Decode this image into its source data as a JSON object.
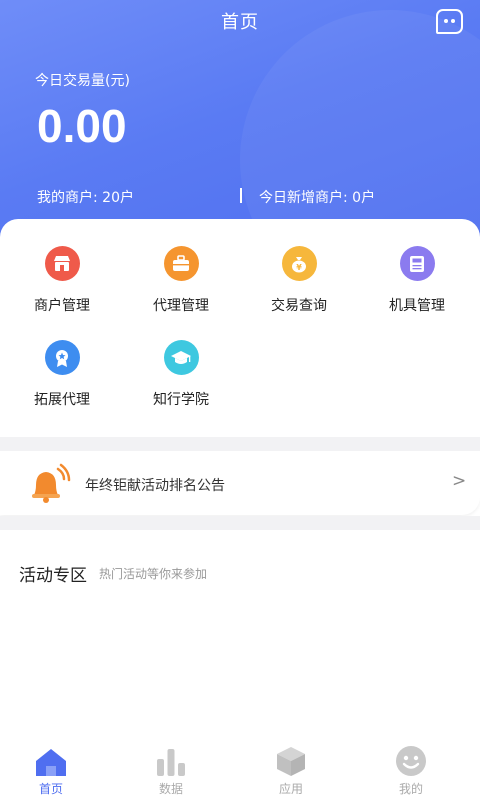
{
  "header": {
    "title": "首页",
    "volume_label": "今日交易量(元)",
    "volume_value": "0.00",
    "my_merchants": "我的商户: 20户",
    "new_merchants_today": "今日新增商户: 0户",
    "message_icon": "message-icon"
  },
  "menu": [
    {
      "label": "商户管理",
      "icon": "store-icon",
      "color": "#ef5a4a"
    },
    {
      "label": "代理管理",
      "icon": "briefcase-icon",
      "color": "#f5952f"
    },
    {
      "label": "交易查询",
      "icon": "money-bag-icon",
      "color": "#f6b73c"
    },
    {
      "label": "机具管理",
      "icon": "pos-terminal-icon",
      "color": "#8b7bef"
    },
    {
      "label": "拓展代理",
      "icon": "award-badge-icon",
      "color": "#3e8df0"
    },
    {
      "label": "知行学院",
      "icon": "graduation-cap-icon",
      "color": "#3ec8e0"
    }
  ],
  "notice": {
    "text": "年终钜献活动排名公告",
    "icon": "bell-icon",
    "arrow": ">"
  },
  "activity": {
    "title": "活动专区",
    "subtitle": "热门活动等你来参加"
  },
  "tabs": [
    {
      "label": "首页",
      "icon": "home-icon",
      "active": true
    },
    {
      "label": "数据",
      "icon": "bar-chart-icon",
      "active": false
    },
    {
      "label": "应用",
      "icon": "cube-icon",
      "active": false
    },
    {
      "label": "我的",
      "icon": "smiley-icon",
      "active": false
    }
  ],
  "colors": {
    "brand": "#5a7bf3",
    "tab_inactive": "#c9c9c9",
    "notice_bell": "#f28a2e"
  }
}
